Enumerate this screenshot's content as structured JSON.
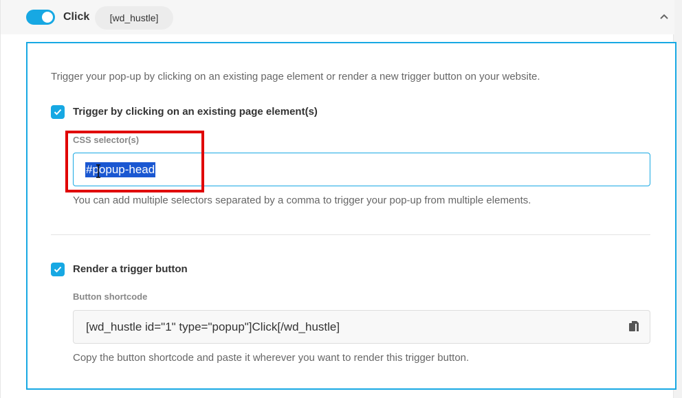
{
  "header": {
    "toggle_on": true,
    "trigger_label": "Click",
    "shortcode_tag": "[wd_hustle]",
    "collapse_icon": "chevron-up-icon"
  },
  "intro_text": "Trigger your pop-up by clicking on an existing page element or render a new trigger button on your website.",
  "existing_element": {
    "checked": true,
    "label": "Trigger by clicking on an existing page element(s)",
    "field_label": "CSS selector(s)",
    "value": "#popup-head",
    "help": "You can add multiple selectors separated by a comma to trigger your pop-up from multiple elements."
  },
  "render_button": {
    "checked": true,
    "label": "Render a trigger button",
    "field_label": "Button shortcode",
    "shortcode": "[wd_hustle id=\"1\" type=\"popup\"]Click[/wd_hustle]",
    "copy_icon": "copy-icon",
    "help": "Copy the button shortcode and paste it wherever you want to render this trigger button."
  },
  "colors": {
    "accent": "#17a8e3",
    "selection": "#1a57d1",
    "highlight_box": "#e00000"
  }
}
